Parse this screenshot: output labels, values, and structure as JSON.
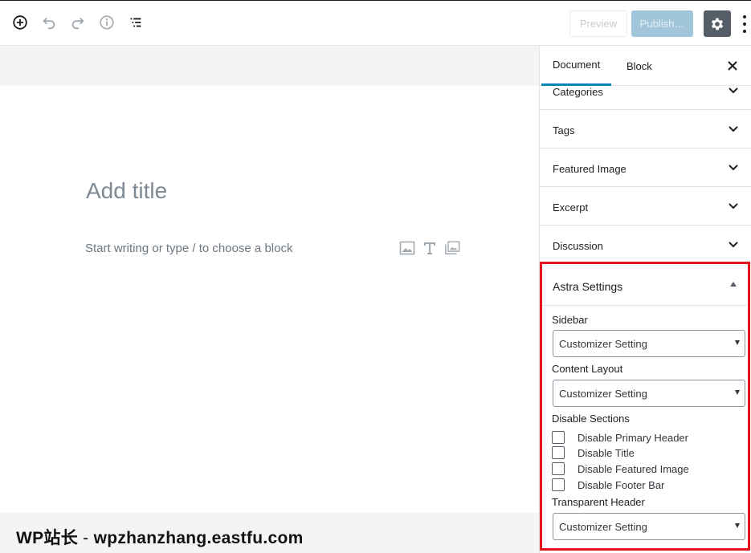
{
  "toolbar": {
    "preview_label": "Preview",
    "publish_label": "Publish…",
    "icons": [
      "add-block-icon",
      "undo-icon",
      "redo-icon",
      "info-icon",
      "outline-icon",
      "gear-icon",
      "more-icon"
    ]
  },
  "editor": {
    "title_placeholder": "Add title",
    "paragraph_placeholder": "Start writing or type / to choose a block",
    "block_icons": [
      "image-icon",
      "heading-icon",
      "gallery-icon"
    ]
  },
  "watermark": {
    "brand": "WP站长",
    "separator": " - ",
    "url": "wpzhanzhang.eastfu.com"
  },
  "sidebar": {
    "tabs": [
      {
        "label": "Document",
        "active": true
      },
      {
        "label": "Block",
        "active": false
      }
    ],
    "panels": [
      {
        "label": "Categories"
      },
      {
        "label": "Tags"
      },
      {
        "label": "Featured Image"
      },
      {
        "label": "Excerpt"
      },
      {
        "label": "Discussion"
      }
    ],
    "astra": {
      "title": "Astra Settings",
      "sidebar_label": "Sidebar",
      "sidebar_value": "Customizer Setting",
      "content_layout_label": "Content Layout",
      "content_layout_value": "Customizer Setting",
      "disable_sections_label": "Disable Sections",
      "checkboxes": [
        {
          "label": "Disable Primary Header",
          "checked": false
        },
        {
          "label": "Disable Title",
          "checked": false
        },
        {
          "label": "Disable Featured Image",
          "checked": false
        },
        {
          "label": "Disable Footer Bar",
          "checked": false
        }
      ],
      "transparent_header_label": "Transparent Header",
      "transparent_header_value": "Customizer Setting"
    }
  },
  "colors": {
    "highlight_border": "#e3141c",
    "active_tab": "#0085ba",
    "publish_bg": "#a2c6d9",
    "settings_bg": "#555d66"
  }
}
